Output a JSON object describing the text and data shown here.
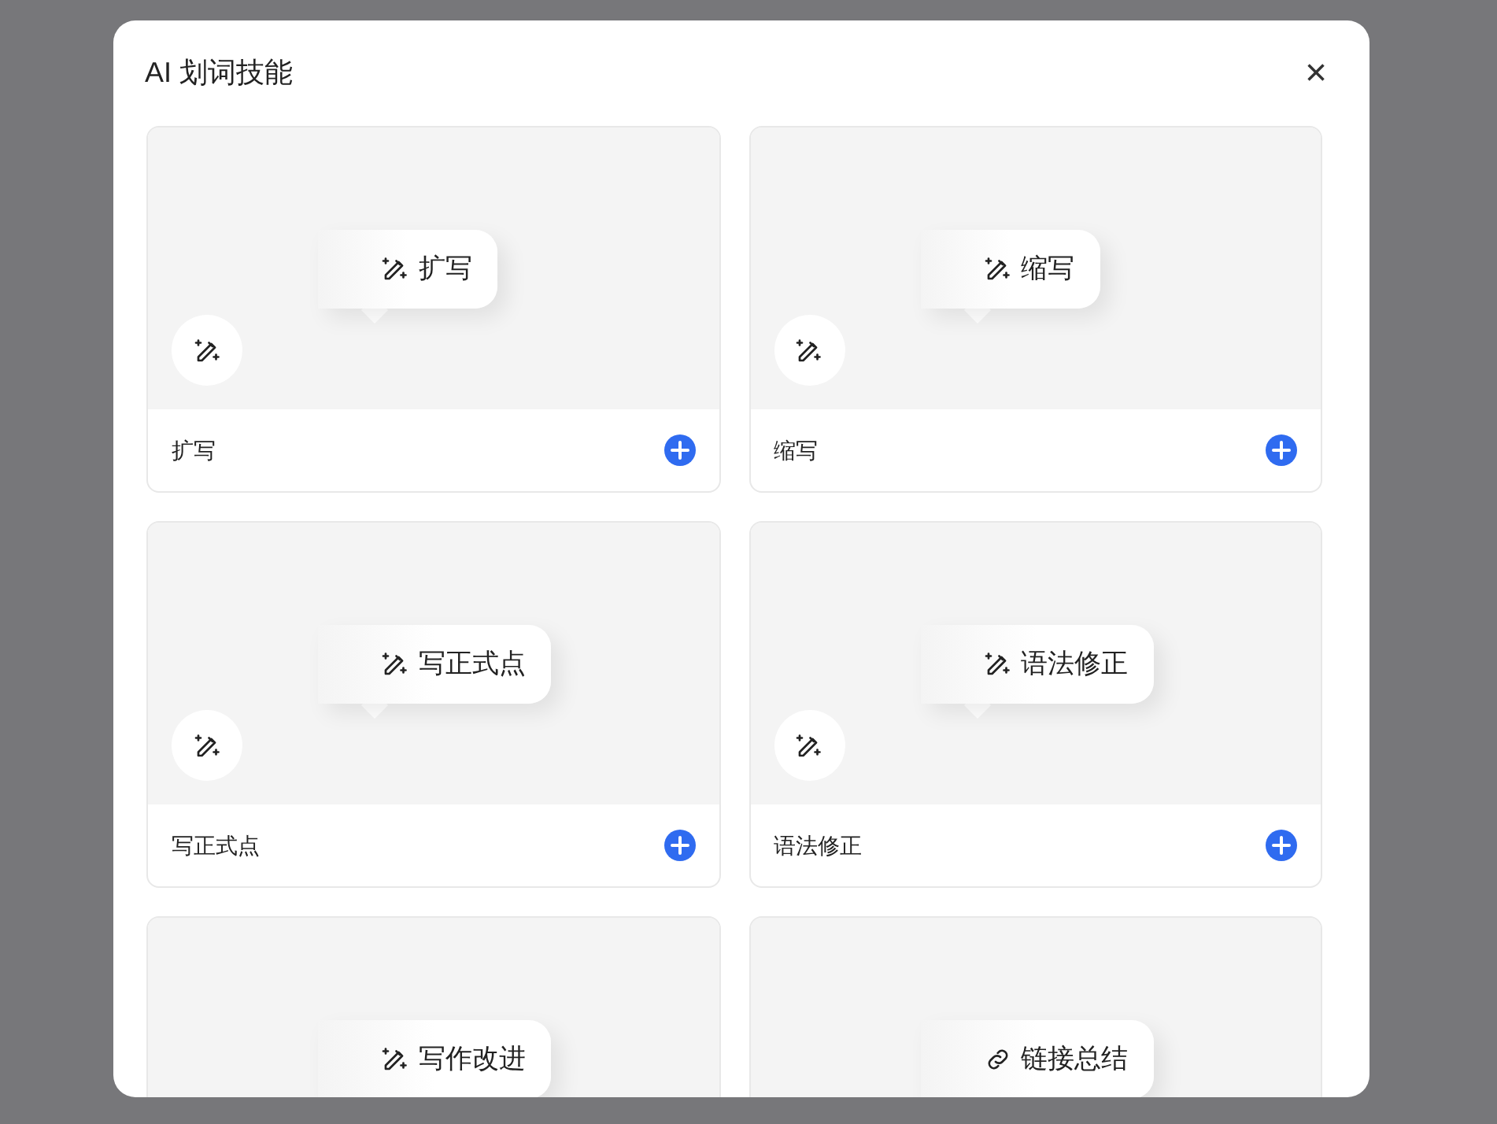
{
  "dialog": {
    "title": "AI 划词技能",
    "close": "×"
  },
  "skills": [
    {
      "preview": {
        "kind": "wand",
        "text": "扩写"
      },
      "label": "扩写"
    },
    {
      "preview": {
        "kind": "wand",
        "text": "缩写"
      },
      "label": "缩写"
    },
    {
      "preview": {
        "kind": "wand",
        "text": "写正式点"
      },
      "label": "写正式点"
    },
    {
      "preview": {
        "kind": "wand",
        "text": "语法修正"
      },
      "label": "语法修正"
    },
    {
      "preview": {
        "kind": "wand",
        "text": "写作改进"
      }
    },
    {
      "preview": {
        "kind": "link",
        "text": "链接总结"
      }
    }
  ]
}
